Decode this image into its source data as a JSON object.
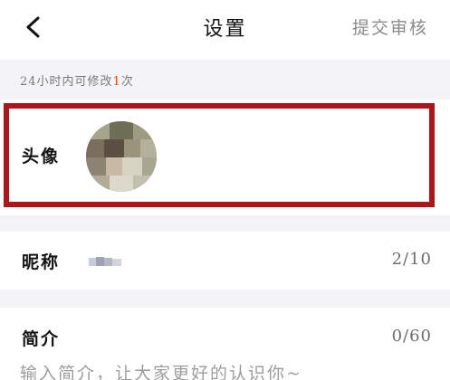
{
  "header": {
    "title": "设置",
    "submit_label": "提交审核"
  },
  "notice": {
    "prefix": "24小时内可修改",
    "count": "1",
    "suffix": "次"
  },
  "avatar_row": {
    "label": "头像"
  },
  "nickname_row": {
    "label": "昵称",
    "counter": "2/10"
  },
  "bio_row": {
    "label": "简介",
    "counter": "0/60",
    "placeholder": "输入简介，让大家更好的认识你~"
  },
  "colors": {
    "highlight_border": "#b0141b",
    "notice_count": "#e84a1c",
    "section_gap": "#f4f4f6"
  },
  "icons": {
    "back": "chevron-left-icon"
  }
}
